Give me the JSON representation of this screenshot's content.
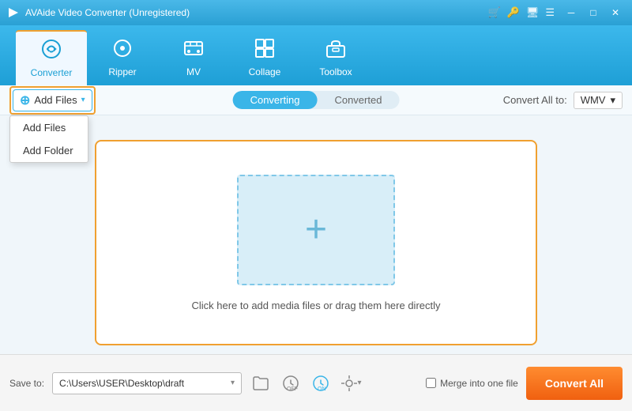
{
  "titleBar": {
    "title": "AVAide Video Converter (Unregistered)",
    "appIcon": "▶",
    "controls": {
      "cart": "🛒",
      "key": "🔑",
      "monitor": "🖥",
      "menu": "☰",
      "minimize": "─",
      "maximize": "□",
      "close": "✕"
    }
  },
  "nav": {
    "items": [
      {
        "id": "converter",
        "label": "Converter",
        "icon": "↻",
        "active": true
      },
      {
        "id": "ripper",
        "label": "Ripper",
        "icon": "⊙",
        "active": false
      },
      {
        "id": "mv",
        "label": "MV",
        "icon": "🖼",
        "active": false
      },
      {
        "id": "collage",
        "label": "Collage",
        "icon": "⊞",
        "active": false
      },
      {
        "id": "toolbox",
        "label": "Toolbox",
        "icon": "🧰",
        "active": false
      }
    ]
  },
  "toolbar": {
    "addFilesLabel": "Add Files",
    "dropdownItems": [
      {
        "label": "Add Files"
      },
      {
        "label": "Add Folder"
      }
    ],
    "tabs": [
      {
        "id": "converting",
        "label": "Converting",
        "active": true
      },
      {
        "id": "converted",
        "label": "Converted",
        "active": false
      }
    ],
    "convertAllTo": {
      "label": "Convert All to:",
      "format": "WMV"
    }
  },
  "dropZone": {
    "text": "Click here to add media files or drag them here directly"
  },
  "footer": {
    "saveToLabel": "Save to:",
    "savePath": "C:\\Users\\USER\\Desktop\\draft",
    "mergeLabel": "Merge into one file",
    "convertAllLabel": "Convert All"
  }
}
